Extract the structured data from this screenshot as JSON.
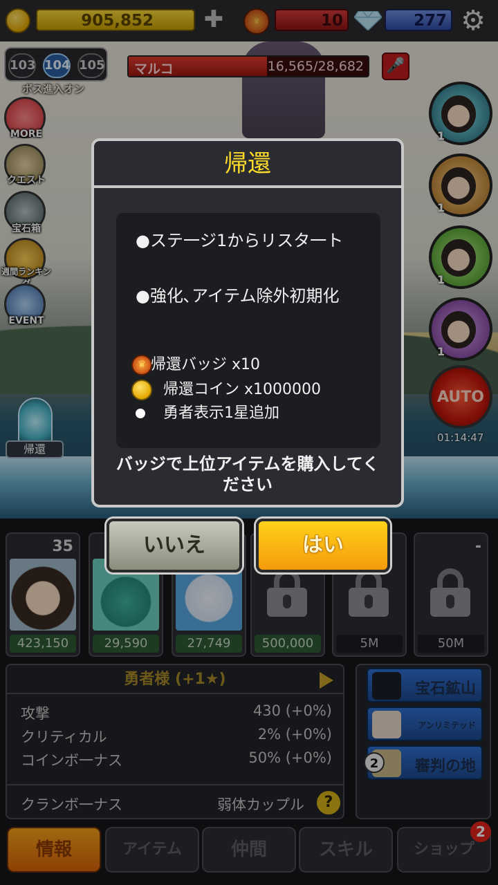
{
  "topbar": {
    "gold": "905,852",
    "plus": "✚",
    "badges": "10",
    "gems": "277",
    "icons": {
      "gold": "gold-coin-icon",
      "badge": "return-badge-icon",
      "gem": "diamond-icon",
      "settings": "gear-icon"
    }
  },
  "stage": {
    "levels": [
      "103",
      "104",
      "105"
    ],
    "boss_toggle": "ボス進入オン",
    "boss": {
      "name": "マルコ",
      "hp": "16,565/28,682",
      "hp_fraction": 0.578
    }
  },
  "side_menu": [
    "MORE",
    "クエスト",
    "宝石箱",
    "週間ランキング",
    "EVENT"
  ],
  "hero_slots": [
    {
      "level": "1"
    },
    {
      "level": "1"
    },
    {
      "level": "1"
    },
    {
      "level": "1"
    }
  ],
  "auto": {
    "label": "AUTO",
    "timer": "01:14:47"
  },
  "return_button": "帰還",
  "dialog": {
    "title": "帰還",
    "line1": "●ステ一ジ1からリスタ一ト",
    "line2": "●強化､アイテム除外初期化",
    "rewards": [
      {
        "icon": "return-badge-icon",
        "text": "帰還バッジ x10"
      },
      {
        "icon": "gold-coin-icon",
        "text": "帰還コイン x1000000"
      },
      {
        "icon": "bullet-icon",
        "text": "勇者表示1星追加"
      }
    ],
    "footer": "バッジで上位アイテムを購入してください",
    "no": "いいえ",
    "yes": "はい"
  },
  "hero_cards": [
    {
      "level": "35",
      "price": "423,150"
    },
    {
      "level": "",
      "price": "29,590"
    },
    {
      "level": "",
      "price": "27,749"
    },
    {
      "level": "",
      "price": "500,000"
    },
    {
      "level": "",
      "price": "5M"
    },
    {
      "level": "-",
      "price": "50M"
    }
  ],
  "stats": {
    "title": "勇者様 (+1★)",
    "rows": [
      {
        "k": "攻撃",
        "v": "430 (+0%)"
      },
      {
        "k": "クリティカル",
        "v": "2% (+0%)"
      },
      {
        "k": "コインボ一ナス",
        "v": "50% (+0%)"
      }
    ],
    "clan_label": "クランボ一ナス",
    "clan_value": "弱体カップル",
    "help": "?"
  },
  "side_panel": {
    "gem_mine": "宝石鉱山",
    "unlimited": "アンリミテッド",
    "judgement": "審判の地",
    "judgement_count": "2"
  },
  "tabs": [
    "情報",
    "アイテム",
    "仲間",
    "スキル",
    "ショップ"
  ],
  "shop_notification": "2",
  "colors": {
    "accent_gold": "#ffdc2a",
    "yes_button": "#f59a0a",
    "no_button": "#8a8c7c"
  }
}
